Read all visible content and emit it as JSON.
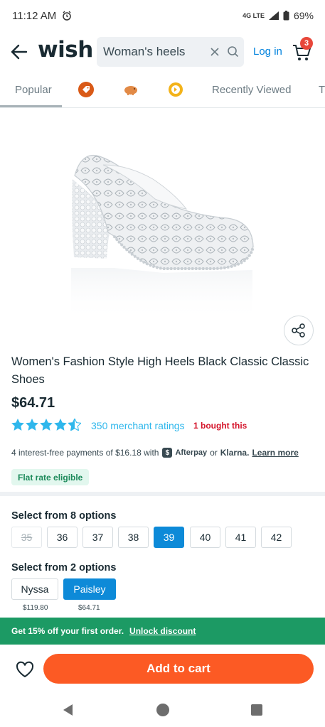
{
  "status": {
    "time": "11:12 AM",
    "network": "4G LTE",
    "battery": "69%"
  },
  "header": {
    "logo": "wish",
    "search_value": "Woman's heels",
    "login_label": "Log in",
    "cart_count": "3"
  },
  "tabs": [
    {
      "label": "Popular"
    },
    {
      "icon": "price-tag-icon"
    },
    {
      "icon": "piggy-bank-icon"
    },
    {
      "icon": "coin-icon"
    },
    {
      "label": "Recently Viewed"
    },
    {
      "label": "Tr"
    }
  ],
  "product": {
    "title": "Women's Fashion Style High Heels Black Classic Classic Shoes",
    "price": "$64.71",
    "rating_stars": 4.5,
    "ratings_label": "350 merchant ratings",
    "bought_label": "1 bought this",
    "installment_text": "4 interest-free payments of $16.18 with",
    "afterpay_label": "Afterpay",
    "or_label": "or",
    "klarna_label": "Klarna.",
    "learn_more_label": "Learn more",
    "flat_rate_label": "Flat rate eligible"
  },
  "sizes": {
    "label": "Select from 8 options",
    "options": [
      "35",
      "36",
      "37",
      "38",
      "39",
      "40",
      "41",
      "42"
    ],
    "disabled": "35",
    "selected": "39"
  },
  "styles": {
    "label": "Select from 2 options",
    "options": [
      {
        "name": "Nyssa",
        "price": "$119.80"
      },
      {
        "name": "Paisley",
        "price": "$64.71"
      }
    ],
    "selected": "Paisley"
  },
  "promo": {
    "text": "Get 15% off your first order.",
    "link": "Unlock discount"
  },
  "actions": {
    "add_to_cart": "Add to cart"
  },
  "colors": {
    "accent": "#0d8ad8",
    "cta": "#fc5a24",
    "promo": "#1c9a64",
    "badge": "#e8473a",
    "link": "#2fb7ec"
  }
}
